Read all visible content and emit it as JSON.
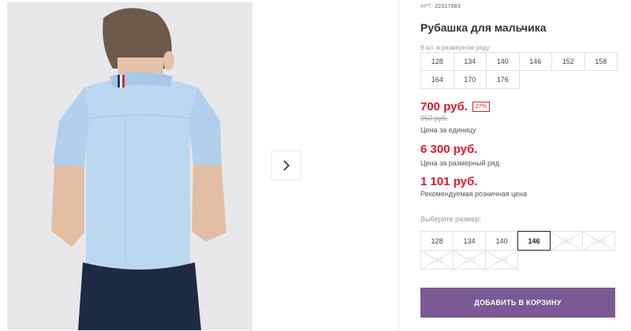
{
  "gallery": {
    "next_icon": "chevron-right-icon",
    "photo_alt": "boy wearing light blue short-sleeve shirt, back view"
  },
  "product": {
    "sku_label": "АРТ:",
    "sku_value": "22317083",
    "title": "Рубашка для мальчика",
    "size_row_note": "9 шт. в размерном ряду",
    "size_row": [
      [
        "128",
        "134",
        "140",
        "146",
        "152",
        "158"
      ],
      [
        "164",
        "170",
        "176",
        "",
        "",
        ""
      ]
    ],
    "price": "700 руб.",
    "discount": "27%",
    "old_price": "960 руб.",
    "unit_note": "Цена за единицу",
    "row_price": "6 300 руб.",
    "row_note": "Цена за размерный ряд",
    "rrp_price": "1 101 руб.",
    "rrp_note": "Рекомендуемая розничная цена",
    "choose_label": "Выберите размер:",
    "size_options": [
      {
        "label": "128",
        "state": "available"
      },
      {
        "label": "134",
        "state": "available"
      },
      {
        "label": "140",
        "state": "available"
      },
      {
        "label": "146",
        "state": "selected"
      },
      {
        "label": "152",
        "state": "disabled"
      },
      {
        "label": "158",
        "state": "disabled"
      },
      {
        "label": "164",
        "state": "disabled"
      },
      {
        "label": "170",
        "state": "disabled"
      },
      {
        "label": "176",
        "state": "disabled"
      }
    ],
    "cart_button": "ДОБАВИТЬ В КОРЗИНУ"
  },
  "colors": {
    "price_red": "#e0192c",
    "cart_purple": "#7a5a94",
    "shirt_blue": "#bcd8f0"
  }
}
